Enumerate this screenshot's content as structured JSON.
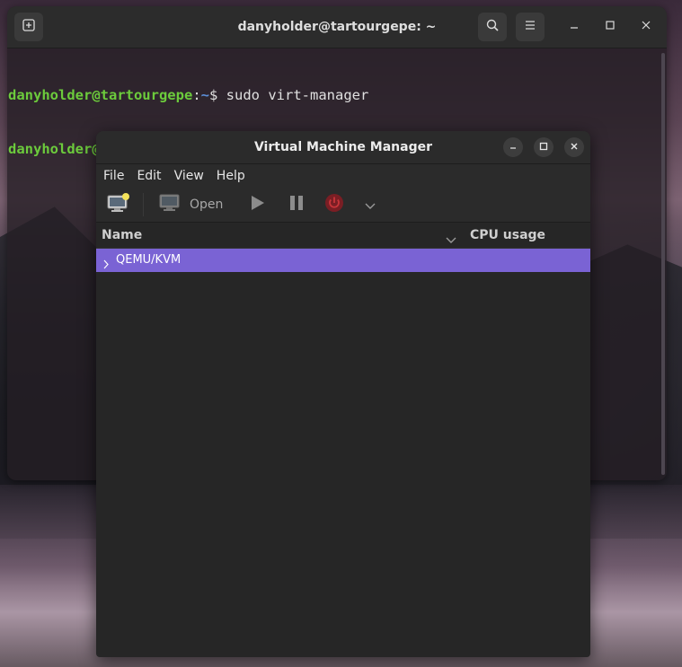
{
  "terminal": {
    "title": "danyholder@tartourgepe: ~",
    "lines": [
      {
        "user": "danyholder@tartourgepe",
        "sep": ":",
        "path": "~",
        "dollar": "$ ",
        "command": "sudo virt-manager"
      },
      {
        "user": "danyholder@tartourgepe",
        "sep": ":",
        "path": "~",
        "dollar": "$ ",
        "command": ""
      }
    ],
    "icons": {
      "new_tab": "new-tab-icon",
      "search": "search-icon",
      "menu": "hamburger-menu-icon",
      "minimize": "minimize-icon",
      "maximize": "maximize-icon",
      "close": "close-icon"
    }
  },
  "vmm": {
    "title": "Virtual Machine Manager",
    "menu": [
      "File",
      "Edit",
      "View",
      "Help"
    ],
    "toolbar": {
      "open_label": "Open"
    },
    "columns": {
      "name": "Name",
      "cpu": "CPU usage"
    },
    "rows": [
      {
        "label": "QEMU/KVM",
        "selected": true
      }
    ],
    "colors": {
      "selection": "#7a63d4",
      "shutdown_icon": "#c8353a",
      "prompt_user": "#6ccb3c",
      "prompt_path": "#5c8fd8"
    }
  }
}
